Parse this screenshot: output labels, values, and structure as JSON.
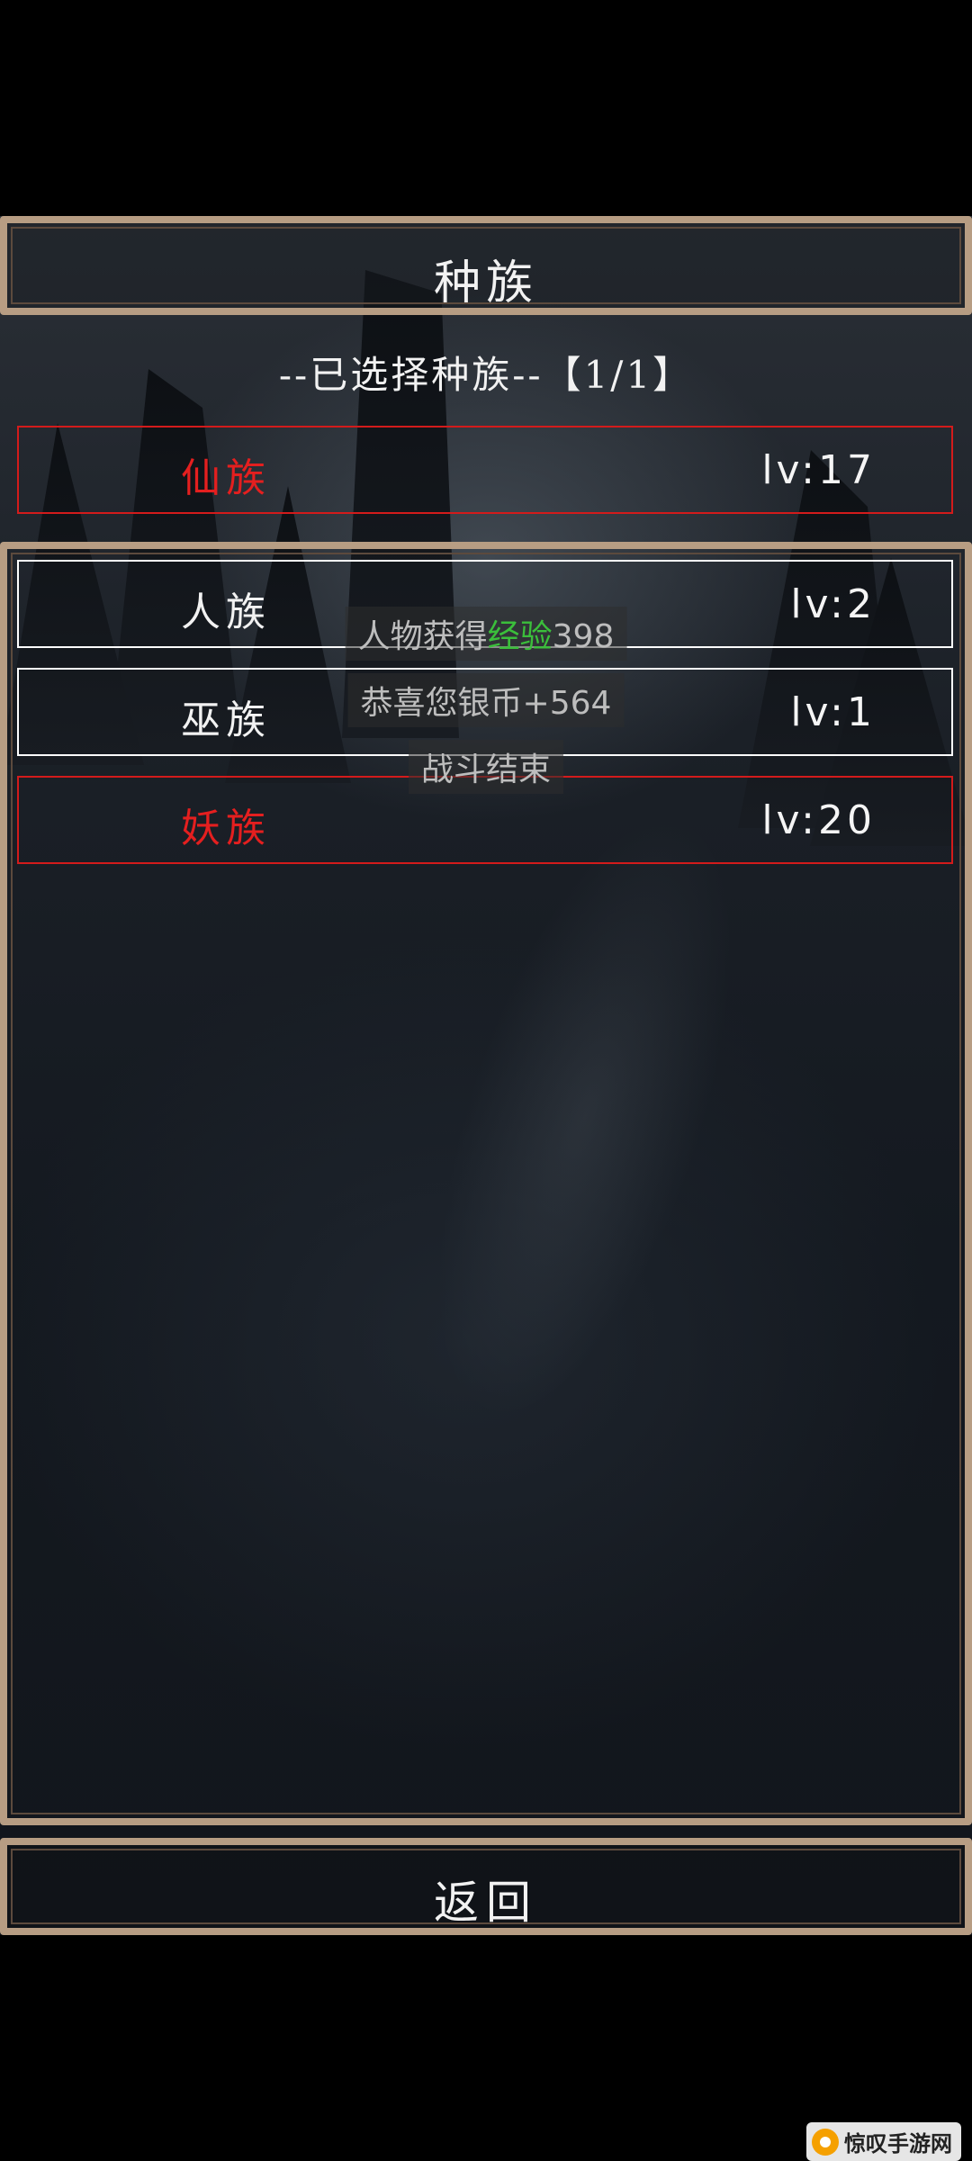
{
  "header": {
    "title": "种族"
  },
  "selected": {
    "label": "--已选择种族--【1/1】"
  },
  "selected_race": {
    "name": "仙族",
    "level": "lv:17",
    "color": "#e41f1f"
  },
  "races": [
    {
      "name": "人族",
      "level": "lv:2"
    },
    {
      "name": "巫族",
      "level": "lv:1"
    },
    {
      "name": "妖族",
      "level": "lv:20"
    }
  ],
  "toasts": {
    "exp_prefix": "人物获得",
    "exp_highlight": "经验",
    "exp_value": "398",
    "silver": "恭喜您银币+564",
    "battle_end": "战斗结束"
  },
  "footer": {
    "back_label": "返回"
  },
  "watermark": {
    "text": "惊叹手游网"
  },
  "colors": {
    "frame": "#b79d83",
    "highlight_red": "#d31b1b",
    "exp_green": "#3bbf3b"
  }
}
